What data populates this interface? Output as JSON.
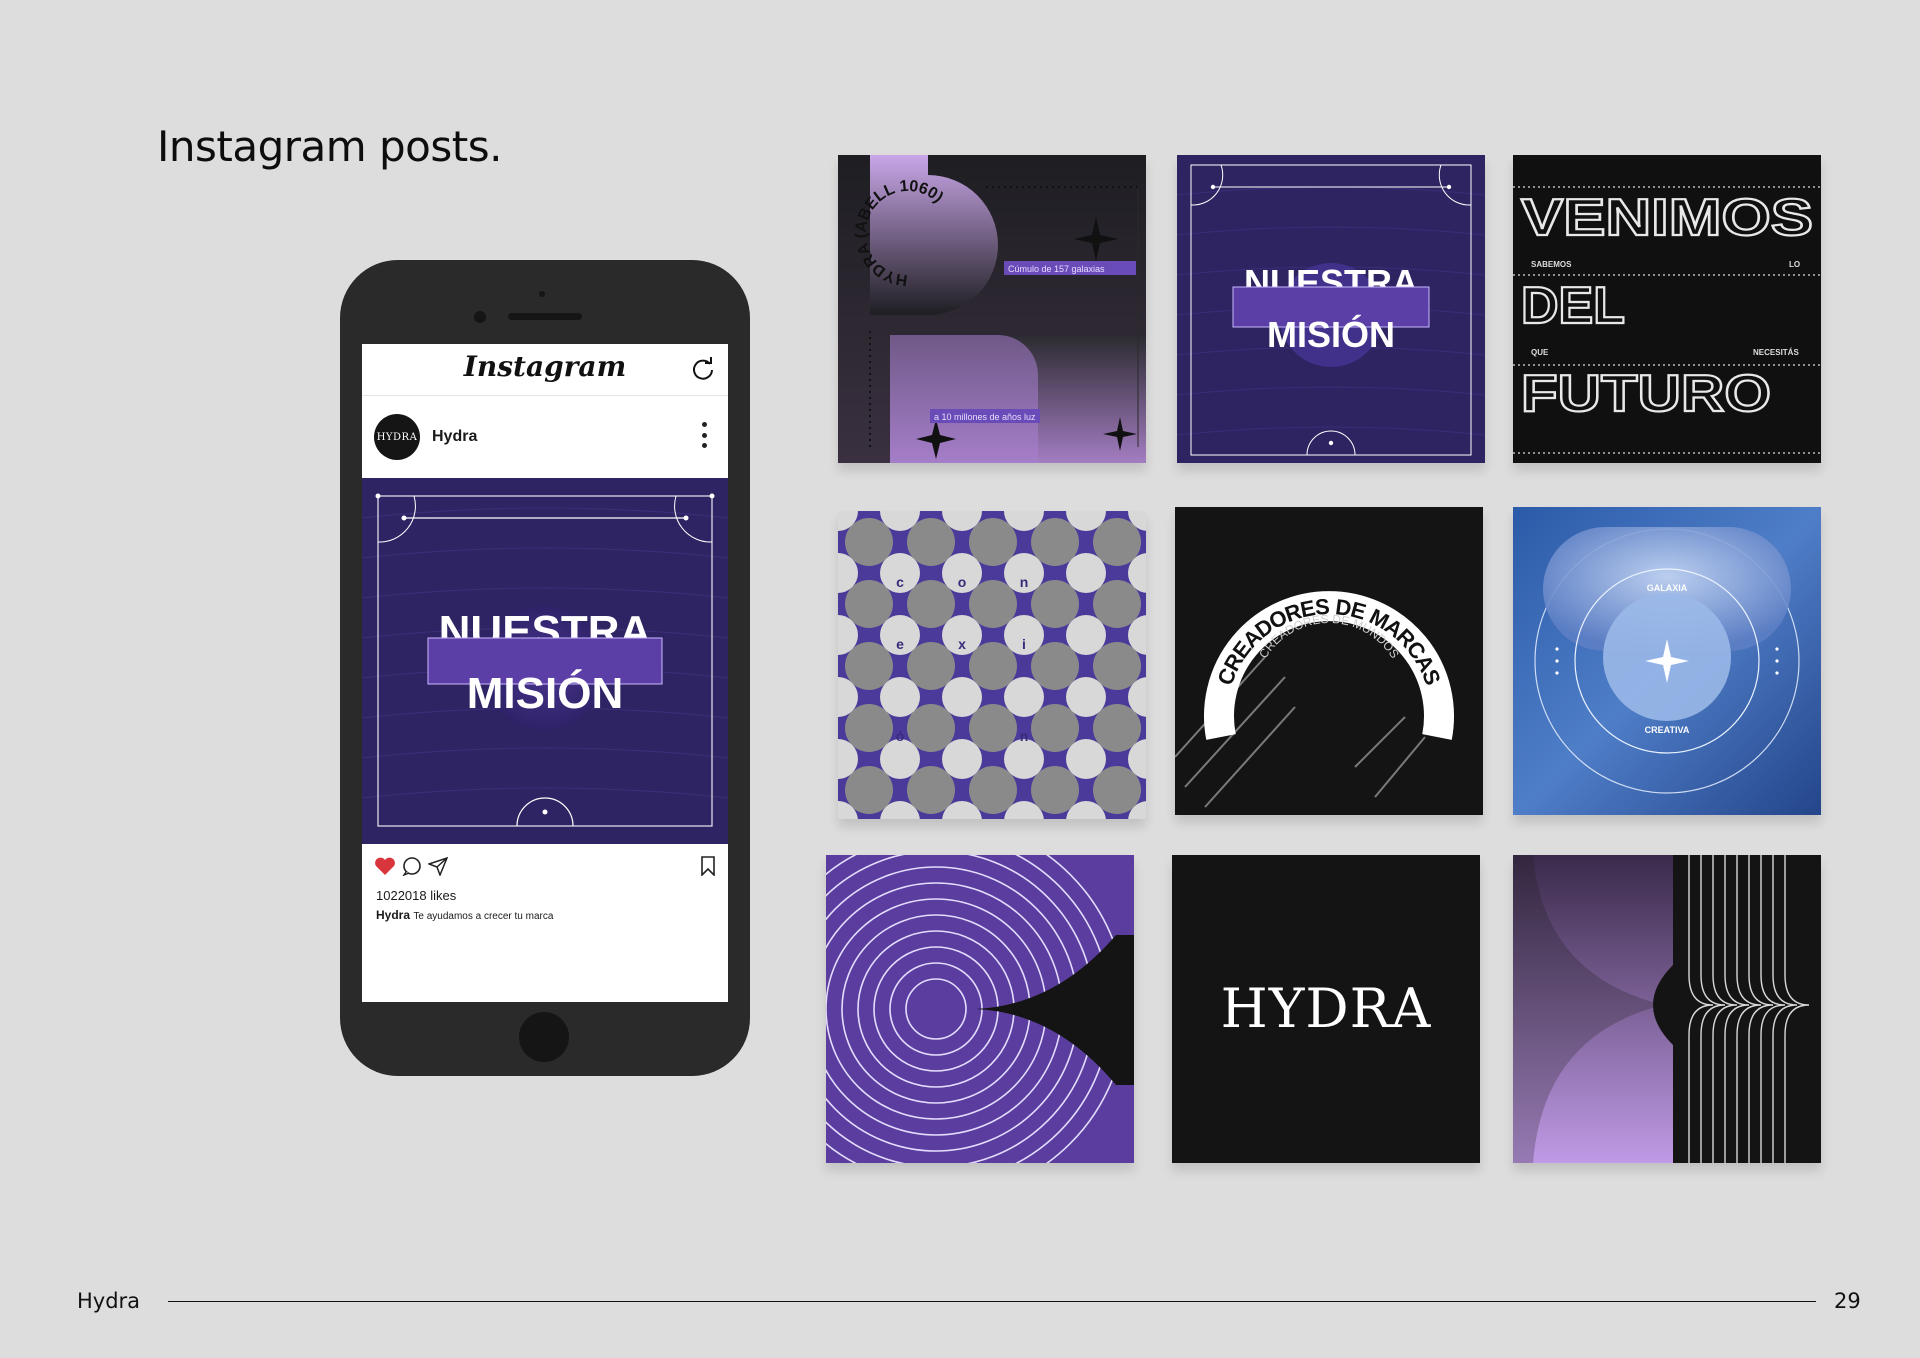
{
  "page": {
    "title": "Instagram posts.",
    "footer_brand": "Hydra",
    "page_number": "29"
  },
  "phone": {
    "app_name": "Instagram",
    "avatar_text": "HYDRA",
    "username": "Hydra",
    "likes": "1022018 likes",
    "caption_user": "Hydra",
    "caption_text": "Te ayudamos a crecer tu marca",
    "post_title_1": "NUESTRA",
    "post_title_2": "MISIÓN"
  },
  "posts": {
    "p1": {
      "arc_text": "HYDRA (ABELL 1060)",
      "label_a": "Cúmulo de 157 galaxias",
      "label_b": "a 10 millones de años luz"
    },
    "p2": {
      "title_1": "NUESTRA",
      "title_2": "MISIÓN"
    },
    "p3": {
      "word_1": "VENIMOS",
      "word_2": "DEL",
      "word_3": "FUTURO",
      "small_1": "SABEMOS",
      "small_2": "LO",
      "small_3": "QUE",
      "small_4": "NECESITÁS"
    },
    "p4": {
      "letters": [
        "c",
        "o",
        "n",
        "e",
        "x",
        "i",
        "ó",
        "n"
      ]
    },
    "p5": {
      "arc_big": "CREADORES DE MARCAS",
      "arc_small": "CREADORES DE MUNDOS"
    },
    "p6": {
      "label_top": "GALAXIA",
      "label_bottom": "CREATIVA"
    },
    "p8": {
      "logo": "HYDRA"
    }
  },
  "colors": {
    "purple": "#5a3d9e",
    "purple_dark": "#2a1d55",
    "lilac": "#c9a6e8",
    "blue": "#3f7fc9",
    "black": "#121212"
  }
}
